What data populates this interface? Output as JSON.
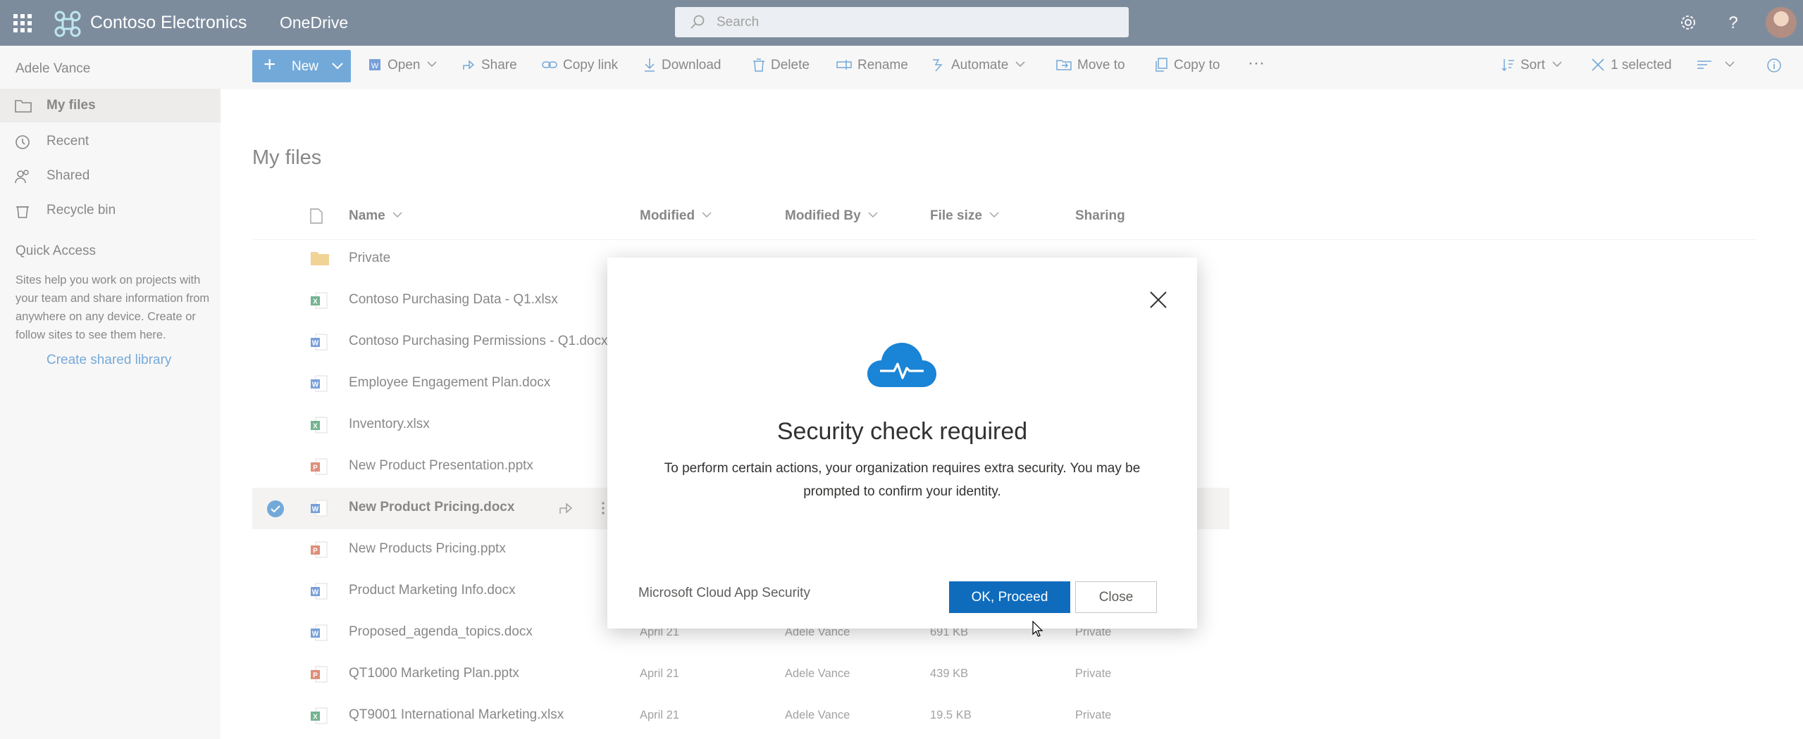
{
  "topbar": {
    "brand": "Contoso Electronics",
    "app_name": "OneDrive",
    "search_placeholder": "Search",
    "icons": [
      "waffle-icon",
      "settings-icon",
      "help-icon"
    ]
  },
  "sidebar": {
    "user_name": "Adele Vance",
    "items": [
      {
        "label": "My files",
        "icon": "folder-icon",
        "active": true
      },
      {
        "label": "Recent",
        "icon": "history-icon"
      },
      {
        "label": "Shared",
        "icon": "people-icon"
      },
      {
        "label": "Recycle bin",
        "icon": "recycle-bin-icon"
      }
    ],
    "quick_access": {
      "title": "Quick Access",
      "description": "Sites help you work on projects with your team and share information from anywhere on any device. Create or follow sites to see them here.",
      "link": "Create shared library"
    }
  },
  "commandbar": {
    "new": "New",
    "open": "Open",
    "share": "Share",
    "copy_link": "Copy link",
    "download": "Download",
    "delete": "Delete",
    "rename": "Rename",
    "automate": "Automate",
    "move_to": "Move to",
    "copy_to": "Copy to",
    "more": "···",
    "sort": "Sort",
    "selected": "1 selected"
  },
  "main": {
    "title": "My files",
    "columns": {
      "name": "Name",
      "modified": "Modified",
      "modified_by": "Modified By",
      "file_size": "File size",
      "sharing": "Sharing"
    },
    "rows": [
      {
        "name": "Private",
        "type": "folder",
        "modified": "",
        "modified_by": "",
        "size": "",
        "sharing": ""
      },
      {
        "name": "Contoso Purchasing Data - Q1.xlsx",
        "type": "excel"
      },
      {
        "name": "Contoso Purchasing Permissions - Q1.docx",
        "type": "word"
      },
      {
        "name": "Employee Engagement Plan.docx",
        "type": "word"
      },
      {
        "name": "Inventory.xlsx",
        "type": "excel"
      },
      {
        "name": "New Product Presentation.pptx",
        "type": "powerpoint"
      },
      {
        "name": "New Product Pricing.docx",
        "type": "word",
        "selected": true
      },
      {
        "name": "New Products Pricing.pptx",
        "type": "powerpoint"
      },
      {
        "name": "Product Marketing Info.docx",
        "type": "word"
      },
      {
        "name": "Proposed_agenda_topics.docx",
        "type": "word",
        "modified": "April 21",
        "modified_by": "Adele Vance",
        "size": "691 KB",
        "sharing": "Private"
      },
      {
        "name": "QT1000 Marketing Plan.pptx",
        "type": "powerpoint",
        "modified": "April 21",
        "modified_by": "Adele Vance",
        "size": "439 KB",
        "sharing": "Private"
      },
      {
        "name": "QT9001 International Marketing.xlsx",
        "type": "excel",
        "modified": "April 21",
        "modified_by": "Adele Vance",
        "size": "19.5 KB",
        "sharing": "Private"
      }
    ]
  },
  "dialog": {
    "icon": "cloud-pulse-icon",
    "title": "Security check required",
    "message": "To perform certain actions, your organization requires extra security. You may be prompted to confirm your identity.",
    "footer": "Microsoft Cloud App Security",
    "ok_label": "OK, Proceed",
    "close_label": "Close"
  },
  "colors": {
    "topbar": "#1f3a57",
    "accent": "#0f6cbd",
    "excel": "#107c41",
    "word": "#185abd",
    "powerpoint": "#c43e1c",
    "folder": "#e8b34a"
  }
}
